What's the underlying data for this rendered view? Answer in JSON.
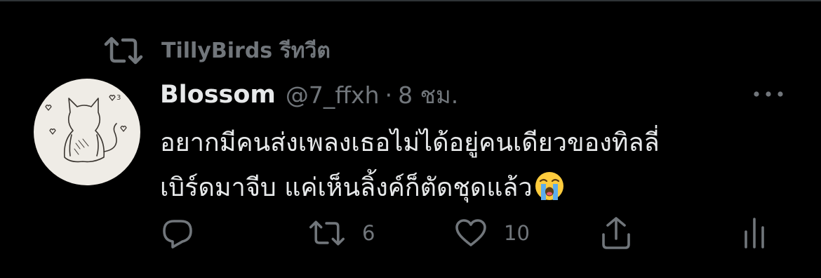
{
  "retweet_context": {
    "text": "TillyBirds รีทวีต",
    "icon": "retweet-icon"
  },
  "tweet": {
    "display_name": "Blossom",
    "handle": "@7_ffxh",
    "separator": "·",
    "time": "8 ชม.",
    "text_lines": [
      "อยากมีคนส่งเพลงเธอไม่ได้อยู่คนเดียวของทิลลี่",
      "เบิร์ดมาจีบ แค่เห็นลิ้งค์ก็ตัดชุดแล้ว"
    ],
    "emoji": "loudly-crying-face-emoji"
  },
  "actions": {
    "reply": {
      "icon": "reply-icon",
      "count": ""
    },
    "retweet": {
      "icon": "retweet-icon",
      "count": "6"
    },
    "like": {
      "icon": "heart-icon",
      "count": "10"
    },
    "share": {
      "icon": "share-icon"
    },
    "analytics": {
      "icon": "analytics-icon"
    }
  },
  "colors": {
    "background": "#000000",
    "primary_text": "#e7e9ea",
    "secondary_text": "#71767b"
  }
}
